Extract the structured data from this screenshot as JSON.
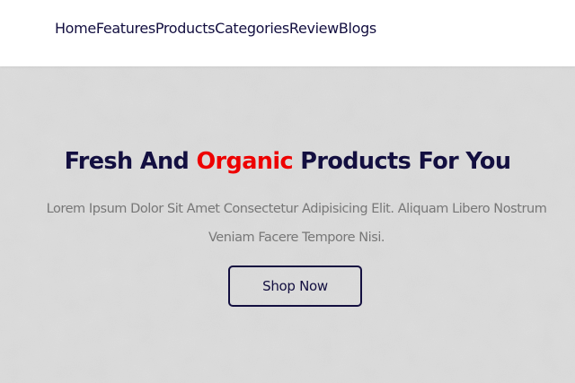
{
  "navbar": {
    "links": [
      "Home",
      "Features",
      "Products",
      "Categories",
      "Review",
      "Blogs"
    ]
  },
  "hero": {
    "title_before": "Fresh And",
    "title_accent": "Organic",
    "title_after": "Products For You",
    "description": "Lorem Ipsum Dolor Sit Amet Consectetur Adipisicing Elit. Aliquam Libero Nostrum Veniam Facere Tempore Nisi.",
    "button_label": "Shop Now"
  },
  "colors": {
    "primary_dark": "#130f40",
    "accent_red": "#ee0000",
    "text_gray": "#777777",
    "hero_background": "#dcdcdc"
  }
}
